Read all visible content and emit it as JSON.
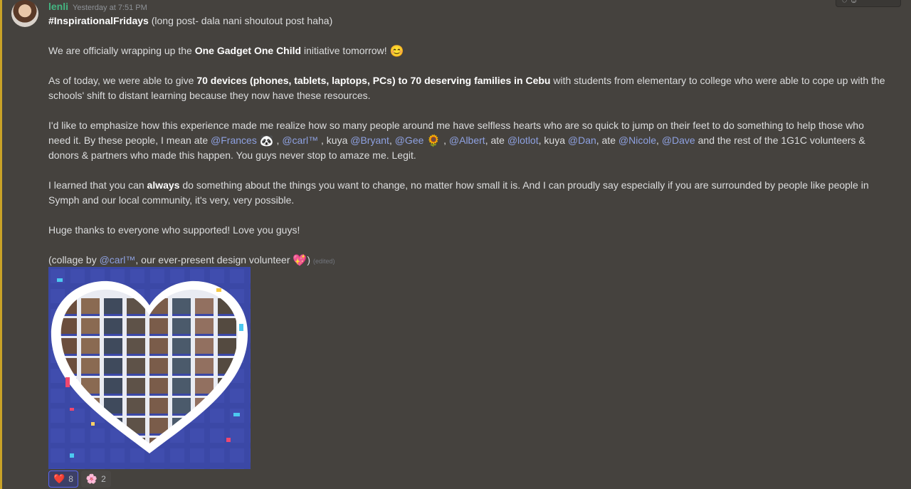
{
  "message": {
    "username": "lenli",
    "timestamp": "Yesterday at 7:51 PM",
    "line1": {
      "bold": "#InspirationalFridays",
      "rest": " (long post- dala nani shoutout post haha)"
    },
    "line2": {
      "pre": "We are officially wrapping up the ",
      "bold": "One Gadget One Child",
      "post": " initiative tomorrow! ",
      "emoji": "😊"
    },
    "line3": {
      "pre": "As of today, we were able to give ",
      "bold": "70 devices (phones, tablets, laptops, PCs) to 70 deserving families in Cebu",
      "post": " with students from elementary to college who were able to cope up with the schools' shift to distant learning because they now have these resources."
    },
    "line4": {
      "pre": "I'd like to emphasize how this experience made me realize how so many people around me have selfless hearts who are so quick to jump on their feet to do something to help those who need it. By these people, I mean ate ",
      "m1": "@Frances",
      "e1": "🐼",
      "s1": " , ",
      "m2": "@carl™",
      "s2": " , kuya ",
      "m3": "@Bryant",
      "s3": ", ",
      "m4": "@Gee",
      "e4": "🌻",
      "s4": " , ",
      "m5": "@Albert",
      "s5": ", ate ",
      "m6": "@lotlot",
      "s6": ", kuya ",
      "m7": "@Dan",
      "s7": ", ate ",
      "m8": "@Nicole",
      "s8": ", ",
      "m9": "@Dave",
      "post": " and the rest of the 1G1C volunteers & donors & partners who made this happen. You guys never stop to amaze me. Legit."
    },
    "line5": {
      "pre": "I learned that you can ",
      "bold": "always",
      "post": " do something about the things you want to change, no matter how small it is. And I can proudly say especially if you are surrounded by people like people in Symph and our local community, it's very, very possible."
    },
    "line6": "Huge thanks to everyone who supported! Love you guys!",
    "line7": {
      "pre": "(collage by ",
      "mention": "@carl™",
      "post": ", our ever-present design volunteer ",
      "emoji": "💖",
      "close": ")",
      "edited": "(edited)"
    }
  },
  "reactions": [
    {
      "icon": "❤️",
      "count": "8",
      "active": true
    },
    {
      "icon": "🌸",
      "count": "2",
      "active": false
    }
  ],
  "colors": {
    "mention": "#8ea1e1",
    "username": "#43b581",
    "background": "#45423e",
    "collage_bg": "#3b48a6"
  }
}
